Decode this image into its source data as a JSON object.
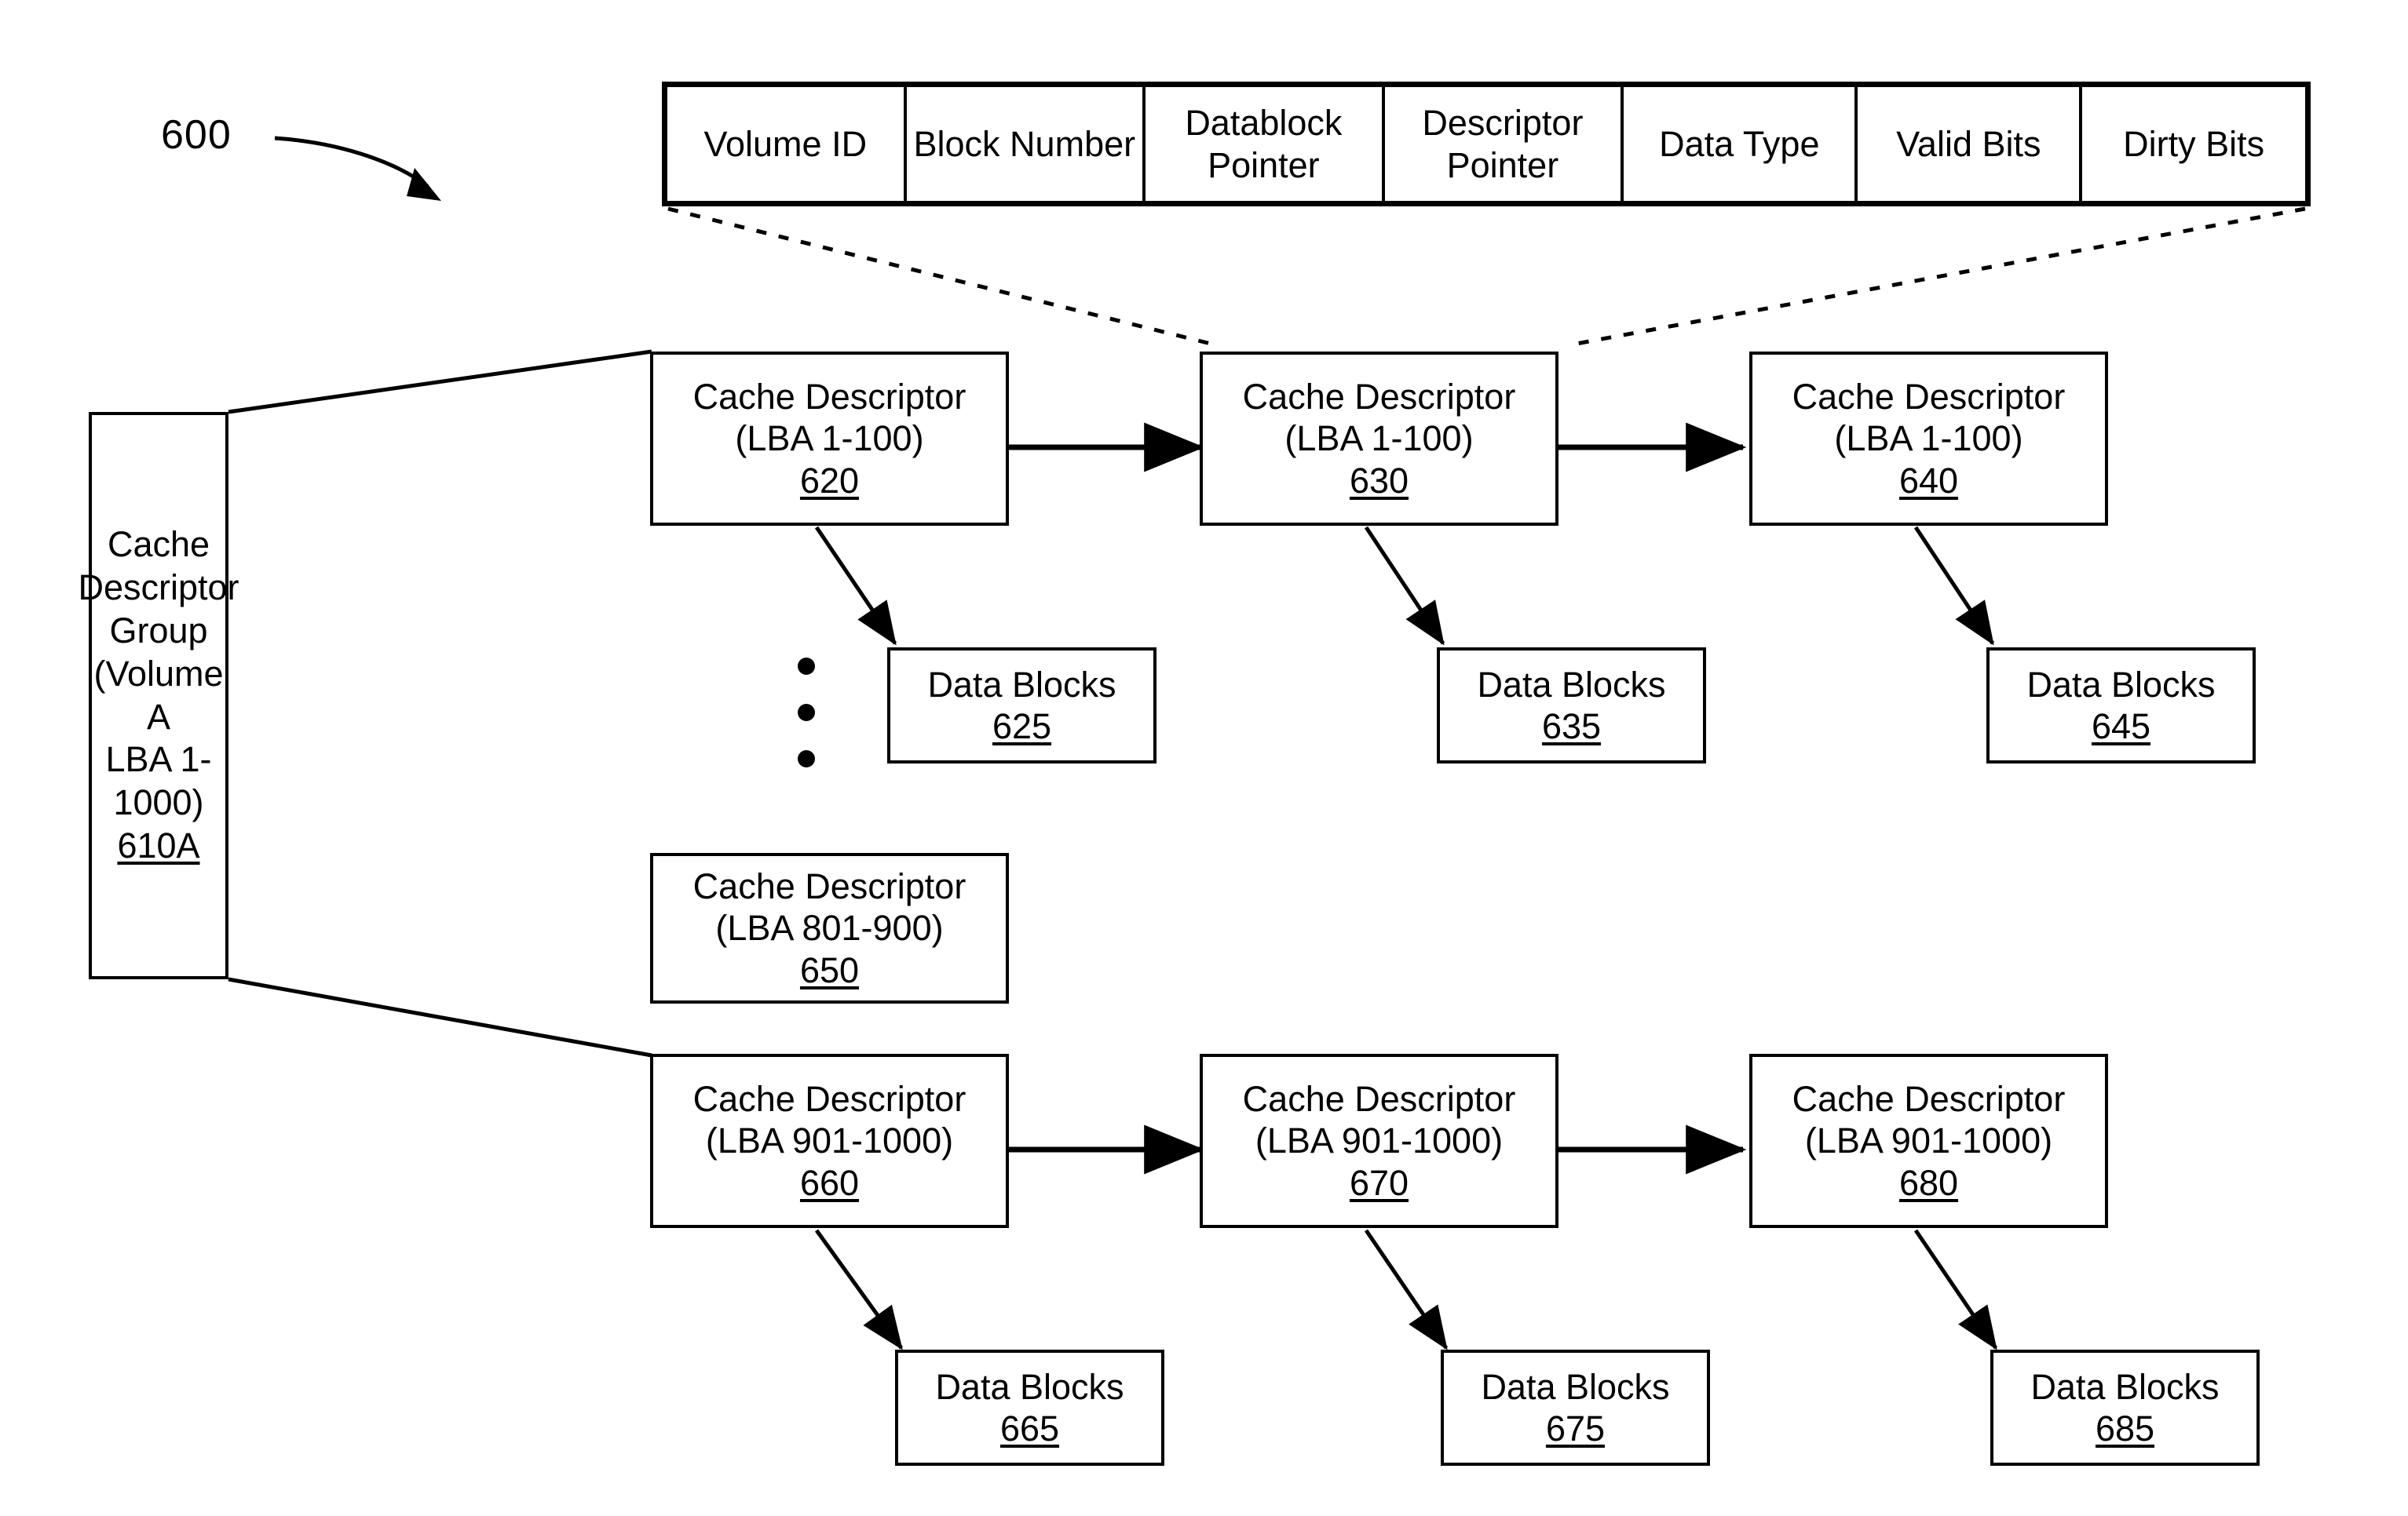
{
  "figure": {
    "number": "600",
    "title_icon": "curved-arrow-icon"
  },
  "attribute_table": {
    "name": "cache-descriptor-attributes",
    "columns": [
      "Volume ID",
      "Block Number",
      "Datablock Pointer",
      "Descriptor Pointer",
      "Data Type",
      "Valid Bits",
      "Dirty Bits"
    ]
  },
  "group": {
    "line1": "Cache Descriptor",
    "line2": "Group",
    "line3": "(Volume A",
    "line4": "LBA 1-1000)",
    "ref": "610A"
  },
  "descriptors": [
    {
      "id": "cd-620",
      "title": "Cache Descriptor",
      "range": "(LBA 1-100)",
      "ref": "620"
    },
    {
      "id": "cd-630",
      "title": "Cache Descriptor",
      "range": "(LBA 1-100)",
      "ref": "630"
    },
    {
      "id": "cd-640",
      "title": "Cache Descriptor",
      "range": "(LBA 1-100)",
      "ref": "640"
    },
    {
      "id": "cd-650",
      "title": "Cache Descriptor",
      "range": "(LBA 801-900)",
      "ref": "650"
    },
    {
      "id": "cd-660",
      "title": "Cache Descriptor",
      "range": "(LBA 901-1000)",
      "ref": "660"
    },
    {
      "id": "cd-670",
      "title": "Cache Descriptor",
      "range": "(LBA 901-1000)",
      "ref": "670"
    },
    {
      "id": "cd-680",
      "title": "Cache Descriptor",
      "range": "(LBA 901-1000)",
      "ref": "680"
    }
  ],
  "datablocks": [
    {
      "id": "db-625",
      "label": "Data Blocks",
      "ref": "625"
    },
    {
      "id": "db-635",
      "label": "Data Blocks",
      "ref": "635"
    },
    {
      "id": "db-645",
      "label": "Data Blocks",
      "ref": "645"
    },
    {
      "id": "db-665",
      "label": "Data Blocks",
      "ref": "665"
    },
    {
      "id": "db-675",
      "label": "Data Blocks",
      "ref": "675"
    },
    {
      "id": "db-685",
      "label": "Data Blocks",
      "ref": "685"
    }
  ],
  "colors": {
    "ink": "#000000",
    "paper": "#ffffff"
  }
}
